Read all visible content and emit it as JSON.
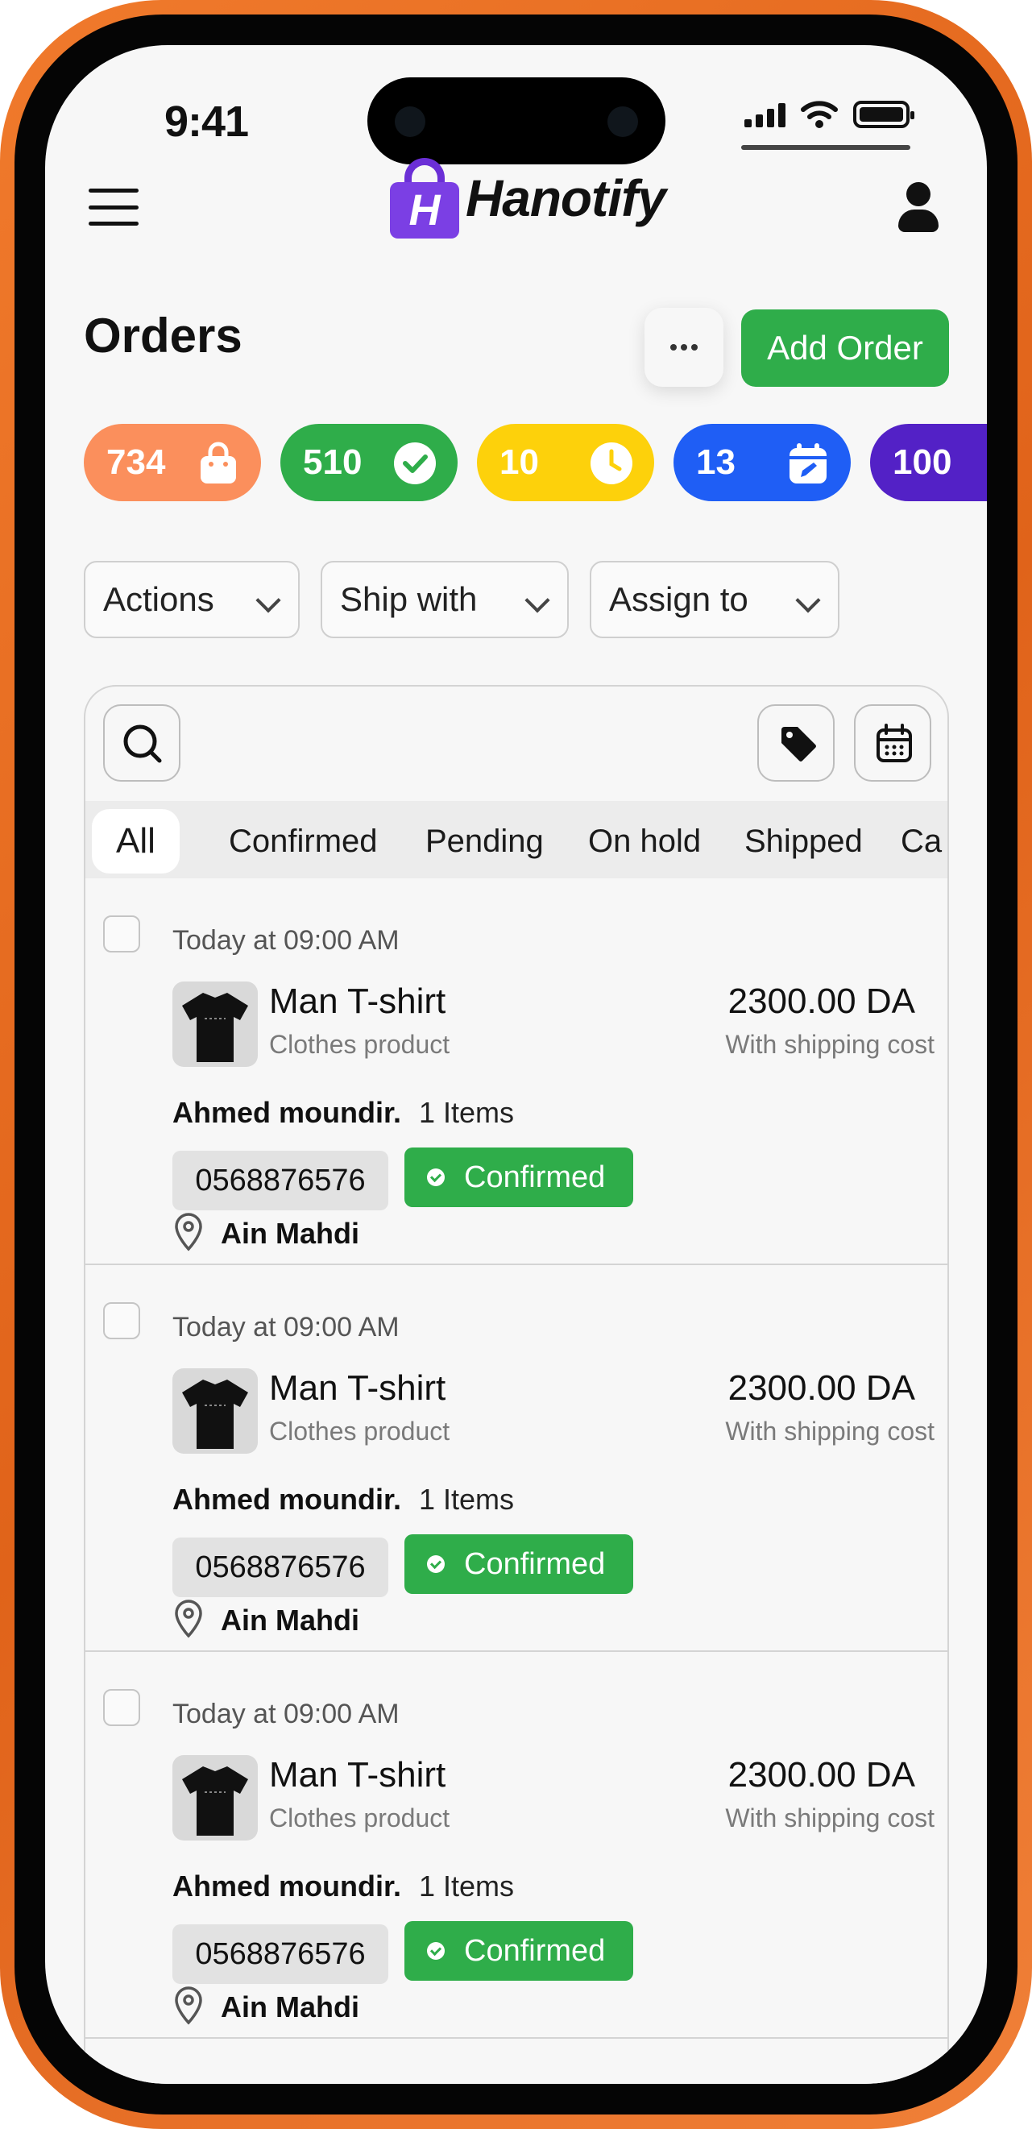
{
  "status_bar": {
    "time": "9:41"
  },
  "brand": {
    "logo_letter": "H",
    "name": "Hanotify",
    "color": "#7b3fe4"
  },
  "page": {
    "title": "Orders",
    "add_order_label": "Add Order"
  },
  "stats": [
    {
      "value": "734",
      "icon": "shopping-bag-icon",
      "color": "#fb8f5c"
    },
    {
      "value": "510",
      "icon": "check-circle-icon",
      "color": "#2fad4a"
    },
    {
      "value": "10",
      "icon": "clock-icon",
      "color": "#fdd10b"
    },
    {
      "value": "13",
      "icon": "calendar-edit-icon",
      "color": "#1f5ef5"
    },
    {
      "value": "100",
      "icon": "alert-icon",
      "color": "#5321c6"
    }
  ],
  "filters": {
    "actions": "Actions",
    "ship_with": "Ship with",
    "assign_to": "Assign to"
  },
  "tabs": [
    "All",
    "Confirmed",
    "Pending",
    "On hold",
    "Shipped",
    "Ca"
  ],
  "active_tab": "All",
  "orders": [
    {
      "time": "Today at 09:00 AM",
      "product": "Man T-shirt",
      "category": "Clothes product",
      "price": "2300.00 DA",
      "price_note": "With shipping cost",
      "customer": "Ahmed moundir.",
      "items": "1 Items",
      "phone": "0568876576",
      "status": "Confirmed",
      "location": "Ain Mahdi"
    },
    {
      "time": "Today at 09:00 AM",
      "product": "Man T-shirt",
      "category": "Clothes product",
      "price": "2300.00 DA",
      "price_note": "With shipping cost",
      "customer": "Ahmed moundir.",
      "items": "1 Items",
      "phone": "0568876576",
      "status": "Confirmed",
      "location": "Ain Mahdi"
    },
    {
      "time": "Today at 09:00 AM",
      "product": "Man T-shirt",
      "category": "Clothes product",
      "price": "2300.00 DA",
      "price_note": "With shipping cost",
      "customer": "Ahmed moundir.",
      "items": "1 Items",
      "phone": "0568876576",
      "status": "Confirmed",
      "location": "Ain Mahdi"
    }
  ],
  "colors": {
    "accent_green": "#2fad4a",
    "frame_orange": "#e8691f"
  }
}
